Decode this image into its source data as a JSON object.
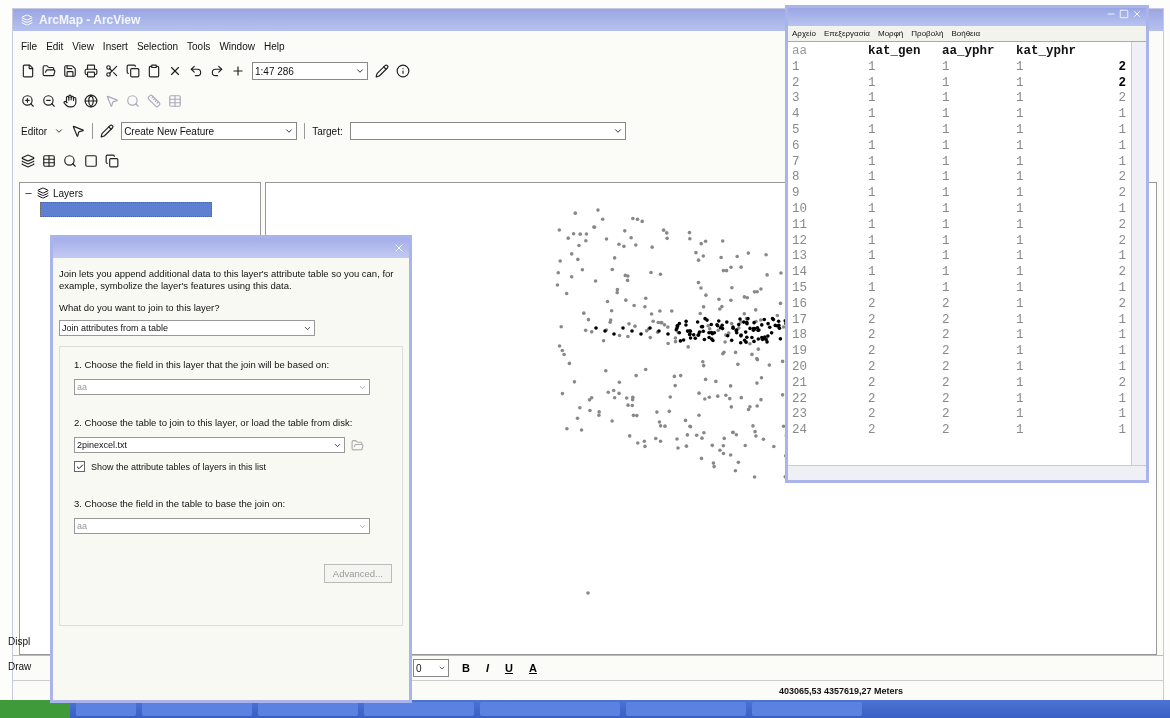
{
  "app": {
    "title": "ArcMap - ArcView",
    "menu": [
      "File",
      "Edit",
      "View",
      "Insert",
      "Selection",
      "Tools",
      "Window",
      "Help"
    ],
    "scale": "1:47 286",
    "editor_label": "Editor",
    "task": "Create New Feature",
    "target_label": "Target:"
  },
  "toc": {
    "title": "Layers",
    "expanded": true,
    "layer": {
      "selected": true
    }
  },
  "side_tabs": [
    "Displ",
    "Draw"
  ],
  "drawing_toolbar": {
    "font_size": "0",
    "buttons": [
      "B",
      "I",
      "U",
      "A"
    ]
  },
  "status_bar": {
    "coordinates": "403065,53 4357619,27 Meters"
  },
  "notepad": {
    "menu": [
      "Αρχείο",
      "Επεξεργασία",
      "Μορφή",
      "Προβολή",
      "Βοήθεια"
    ],
    "columns": [
      "aa",
      "kat_gen",
      "aa_yphr",
      "kat_yphr"
    ],
    "rows": [
      {
        "cells": [
          "1",
          "1",
          "1",
          "1",
          "2"
        ],
        "emphasized": true
      },
      {
        "cells": [
          "2",
          "1",
          "1",
          "1",
          "2"
        ],
        "emphasized": true
      },
      {
        "cells": [
          "3",
          "1",
          "1",
          "1",
          "2"
        ],
        "emphasized": false
      },
      {
        "cells": [
          "4",
          "1",
          "1",
          "1",
          "1"
        ],
        "emphasized": false
      },
      {
        "cells": [
          "5",
          "1",
          "1",
          "1",
          "1"
        ],
        "emphasized": false
      },
      {
        "cells": [
          "6",
          "1",
          "1",
          "1",
          "1"
        ],
        "emphasized": false
      },
      {
        "cells": [
          "7",
          "1",
          "1",
          "1",
          "1"
        ],
        "emphasized": false
      },
      {
        "cells": [
          "8",
          "1",
          "1",
          "1",
          "2"
        ],
        "emphasized": false
      },
      {
        "cells": [
          "9",
          "1",
          "1",
          "1",
          "2"
        ],
        "emphasized": false
      },
      {
        "cells": [
          "10",
          "1",
          "1",
          "1",
          "1"
        ],
        "emphasized": false
      },
      {
        "cells": [
          "11",
          "1",
          "1",
          "1",
          "2"
        ],
        "emphasized": false
      },
      {
        "cells": [
          "12",
          "1",
          "1",
          "1",
          "2"
        ],
        "emphasized": false
      },
      {
        "cells": [
          "13",
          "1",
          "1",
          "1",
          "1"
        ],
        "emphasized": false
      },
      {
        "cells": [
          "14",
          "1",
          "1",
          "1",
          "2"
        ],
        "emphasized": false
      },
      {
        "cells": [
          "15",
          "1",
          "1",
          "1",
          "1"
        ],
        "emphasized": false
      },
      {
        "cells": [
          "16",
          "2",
          "2",
          "1",
          "2"
        ],
        "emphasized": false
      },
      {
        "cells": [
          "17",
          "2",
          "2",
          "1",
          "1"
        ],
        "emphasized": false
      },
      {
        "cells": [
          "18",
          "2",
          "2",
          "1",
          "1"
        ],
        "emphasized": false
      },
      {
        "cells": [
          "19",
          "2",
          "2",
          "1",
          "1"
        ],
        "emphasized": false
      },
      {
        "cells": [
          "20",
          "2",
          "2",
          "1",
          "1"
        ],
        "emphasized": false
      },
      {
        "cells": [
          "21",
          "2",
          "2",
          "1",
          "2"
        ],
        "emphasized": false
      },
      {
        "cells": [
          "22",
          "2",
          "2",
          "1",
          "1"
        ],
        "emphasized": false
      },
      {
        "cells": [
          "23",
          "2",
          "2",
          "1",
          "1"
        ],
        "emphasized": false
      },
      {
        "cells": [
          "24",
          "2",
          "2",
          "1",
          "1"
        ],
        "emphasized": false
      }
    ]
  },
  "join_dialog": {
    "intro": "Join lets you append additional data to this layer's attribute table so you can, for example, symbolize the layer's features using this data.",
    "question": "What do you want to join to this layer?",
    "join_type": "Join attributes from a table",
    "step1": "1.  Choose the field in this layer that the join will be based on:",
    "step1_value": "aa",
    "step2": "2.  Choose the table to join to this layer, or load the table from disk:",
    "step2_value": "2pinexcel.txt",
    "show_tables": {
      "label": "Show the attribute tables of layers in this list",
      "checked": true
    },
    "step3": "3.  Choose the field in the table to base the join on:",
    "step3_value": "aa",
    "advanced": {
      "label": "Advanced...",
      "disabled": true
    }
  }
}
